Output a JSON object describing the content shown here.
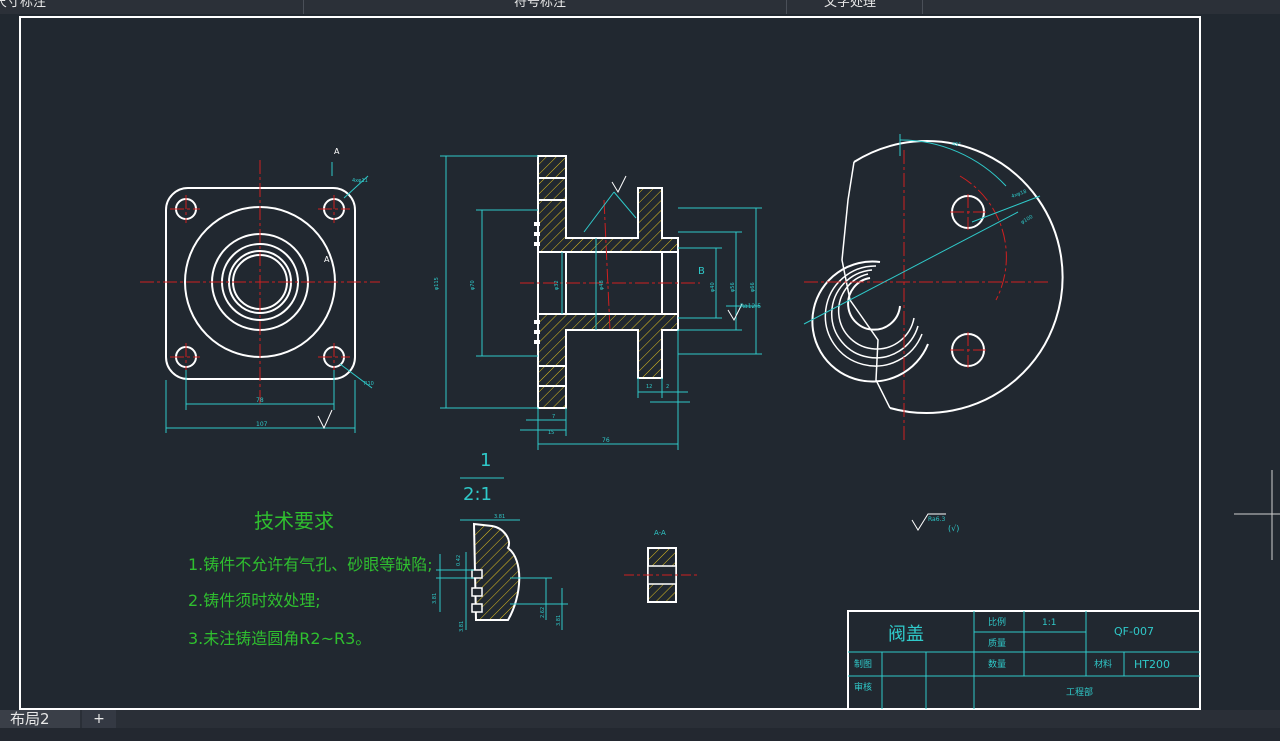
{
  "toolbar": {
    "dim_panel": "尺寸标注",
    "symbol_panel": "符号标注",
    "text_panel": "文字处理"
  },
  "drawing": {
    "tech_req": {
      "title": "技术要求",
      "items": [
        "1.铸件不允许有气孔、砂眼等缺陷;",
        "2.铸件须时效处理;",
        "3.未注铸造圆角R2~R3。"
      ]
    },
    "detail_scale_num": "1",
    "detail_scale": "2:1",
    "section_label": "A-A",
    "view_label_a": "A",
    "view_label_b": "B",
    "roughness_note": "Ra6.3",
    "roughness_paren": "(√)",
    "dims": {
      "front_inner": "78",
      "front_outer": "107",
      "front_r": "R10",
      "front_hole": "4xφ11",
      "side_height": "φ115",
      "side_d1": "φ70",
      "side_d2": "φ32",
      "side_d3": "φ48",
      "side_d4": "φ56",
      "side_d5": "φ40",
      "side_d6": "φ66",
      "side_len": "76",
      "side_l1": "15",
      "side_l2": "7",
      "side_l3": "12",
      "side_l4": "2",
      "side_ra": "Ra12.5",
      "right_angle": "45°",
      "right_h1": "4xφ18",
      "right_pcd": "φ100",
      "detail_w": "3.81",
      "detail_h1": "0.42",
      "detail_h2": "3.81",
      "detail_h3": "3.81",
      "detail_r1": "2.62",
      "detail_r2": "3.81",
      "front_ang": "4xφ11"
    }
  },
  "title_block": {
    "part_name": "阀盖",
    "scale_label": "比例",
    "scale_value": "1:1",
    "qty_label": "数量",
    "weight_label": "质量",
    "drawing_no": "QF-007",
    "draw_label": "制图",
    "check_label": "审核",
    "material_label": "材料",
    "material": "HT200",
    "company": "工程部"
  },
  "tabs": {
    "layout": "布局2",
    "add": "+"
  },
  "colors": {
    "background": "#212830",
    "lines": "#ffffff",
    "dims": "#2fc9c9",
    "center": "#d02020",
    "text_green": "#2fbf2f"
  }
}
